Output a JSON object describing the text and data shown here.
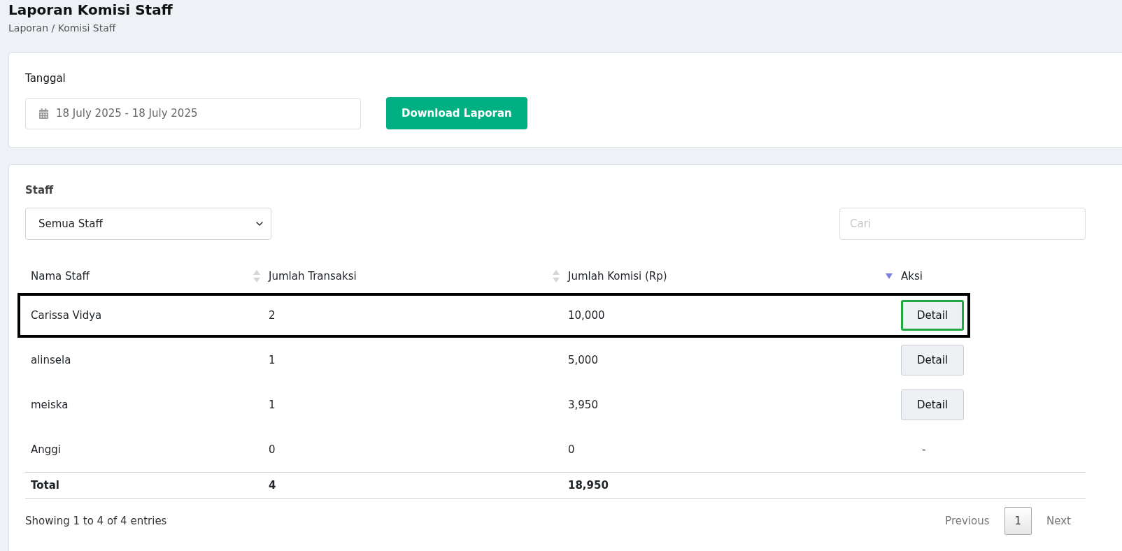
{
  "page": {
    "title": "Laporan Komisi Staff",
    "breadcrumb": "Laporan / Komisi Staff"
  },
  "filter": {
    "label": "Tanggal",
    "date_range": "18 July 2025 - 18 July 2025",
    "download_button": "Download Laporan"
  },
  "staff_filter": {
    "label": "Staff",
    "value": "Semua Staff"
  },
  "search": {
    "placeholder": "Cari"
  },
  "table": {
    "columns": [
      {
        "label": "Nama Staff",
        "sorted": false
      },
      {
        "label": "Jumlah Transaksi",
        "sorted": false
      },
      {
        "label": "Jumlah Komisi (Rp)",
        "sorted": true
      },
      {
        "label": "Aksi"
      }
    ],
    "rows": [
      {
        "name": "Carissa Vidya",
        "transactions": "2",
        "commission": "10,000",
        "action": "Detail",
        "kind": "button",
        "highlighted": true
      },
      {
        "name": "alinsela",
        "transactions": "1",
        "commission": "5,000",
        "action": "Detail",
        "kind": "button",
        "highlighted": false
      },
      {
        "name": "meiska",
        "transactions": "1",
        "commission": "3,950",
        "action": "Detail",
        "kind": "button",
        "highlighted": false
      },
      {
        "name": "Anggi",
        "transactions": "0",
        "commission": "0",
        "action": "-",
        "kind": "text",
        "highlighted": false
      }
    ],
    "total": {
      "label": "Total",
      "transactions": "4",
      "commission": "18,950"
    }
  },
  "footer": {
    "info": "Showing 1 to 4 of 4 entries",
    "pagination": [
      {
        "label": "Previous",
        "selected": false
      },
      {
        "label": "1",
        "selected": true
      },
      {
        "label": "Next",
        "selected": false
      }
    ]
  }
}
